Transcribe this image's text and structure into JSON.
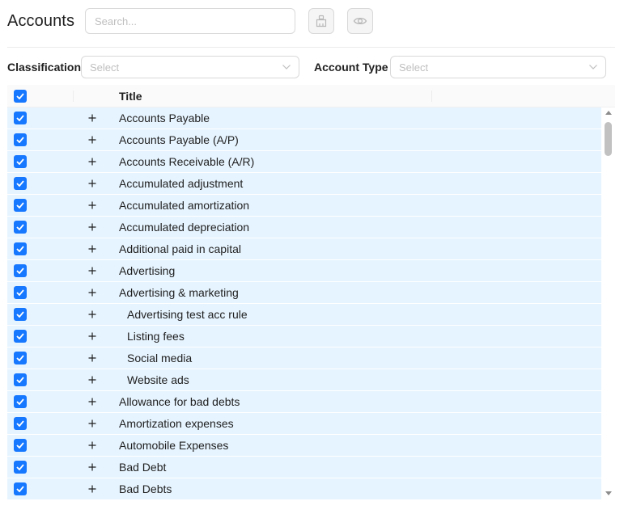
{
  "header": {
    "title": "Accounts",
    "search_placeholder": "Search..."
  },
  "filters": {
    "classification_label": "Classification",
    "classification_placeholder": "Select",
    "account_type_label": "Account Type",
    "account_type_placeholder": "Select"
  },
  "table": {
    "columns": {
      "title": "Title"
    },
    "rows": [
      {
        "title": "Accounts Payable",
        "child": false
      },
      {
        "title": "Accounts Payable (A/P)",
        "child": false
      },
      {
        "title": "Accounts Receivable (A/R)",
        "child": false
      },
      {
        "title": "Accumulated adjustment",
        "child": false
      },
      {
        "title": "Accumulated amortization",
        "child": false
      },
      {
        "title": "Accumulated depreciation",
        "child": false
      },
      {
        "title": "Additional paid in capital",
        "child": false
      },
      {
        "title": "Advertising",
        "child": false
      },
      {
        "title": "Advertising & marketing",
        "child": false
      },
      {
        "title": "Advertising test acc rule",
        "child": true
      },
      {
        "title": "Listing fees",
        "child": true
      },
      {
        "title": "Social media",
        "child": true
      },
      {
        "title": "Website ads",
        "child": true
      },
      {
        "title": "Allowance for bad debts",
        "child": false
      },
      {
        "title": "Amortization expenses",
        "child": false
      },
      {
        "title": "Automobile Expenses",
        "child": false
      },
      {
        "title": "Bad Debt",
        "child": false
      },
      {
        "title": "Bad Debts",
        "child": false
      }
    ]
  },
  "icons": {
    "clear": "clear-filter-icon",
    "eye": "eye-icon",
    "chevron": "chevron-down-icon",
    "check": "check-icon",
    "expand": "plus-icon"
  },
  "colors": {
    "accent": "#1677ff",
    "row_selected": "#e6f4ff"
  }
}
